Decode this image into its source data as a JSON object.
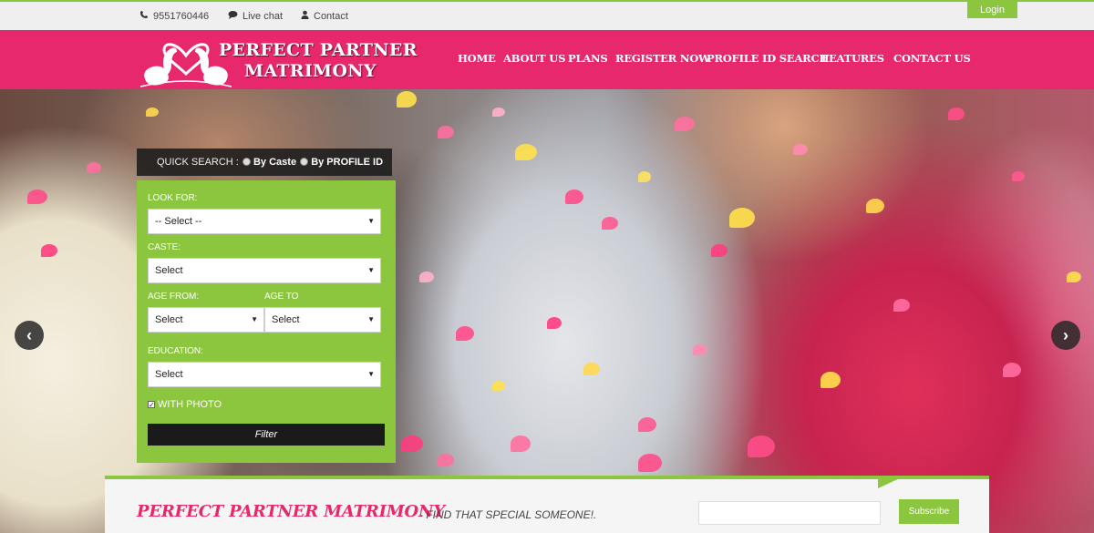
{
  "topbar": {
    "phone": "9551760446",
    "live_chat": "Live chat",
    "contact": "Contact",
    "login": "Login",
    "icons": [
      "phone-icon",
      "chat-icon",
      "user-icon"
    ]
  },
  "brand": {
    "line1": "PERFECT PARTNER",
    "line2": "MATRIMONY",
    "primary_color": "#e8286c",
    "accent_color": "#8cc63f"
  },
  "nav": {
    "items": [
      {
        "label": "HOME"
      },
      {
        "label": "ABOUT US"
      },
      {
        "label": "PLANS"
      },
      {
        "label": "REGISTER NOW"
      },
      {
        "label": "PROFILE ID SEARCH"
      },
      {
        "label": "FEATURES"
      },
      {
        "label": "CONTACT US"
      }
    ]
  },
  "slider": {
    "prev_glyph": "‹",
    "next_glyph": "›"
  },
  "quick_search": {
    "title": "QUICK SEARCH :",
    "option_caste": "By Caste",
    "option_profile": "By PROFILE ID",
    "look_for_label": "LOOK FOR:",
    "look_for_value": "-- Select --",
    "caste_label": "CASTE:",
    "caste_value": "Select",
    "age_from_label": "AGE FROM:",
    "age_from_value": "Select",
    "age_to_label": "AGE TO",
    "age_to_value": "Select",
    "education_label": "EDUCATION:",
    "education_value": "Select",
    "with_photo_label": "WITH PHOTO",
    "with_photo_checked": true,
    "filter_label": "Filter"
  },
  "footer_strip": {
    "tagline": "PERFECT PARTNER MATRIMONY",
    "subtitle": "- FIND THAT SPECIAL SOMEONE!.",
    "subscribe_label": "Subscribe"
  }
}
